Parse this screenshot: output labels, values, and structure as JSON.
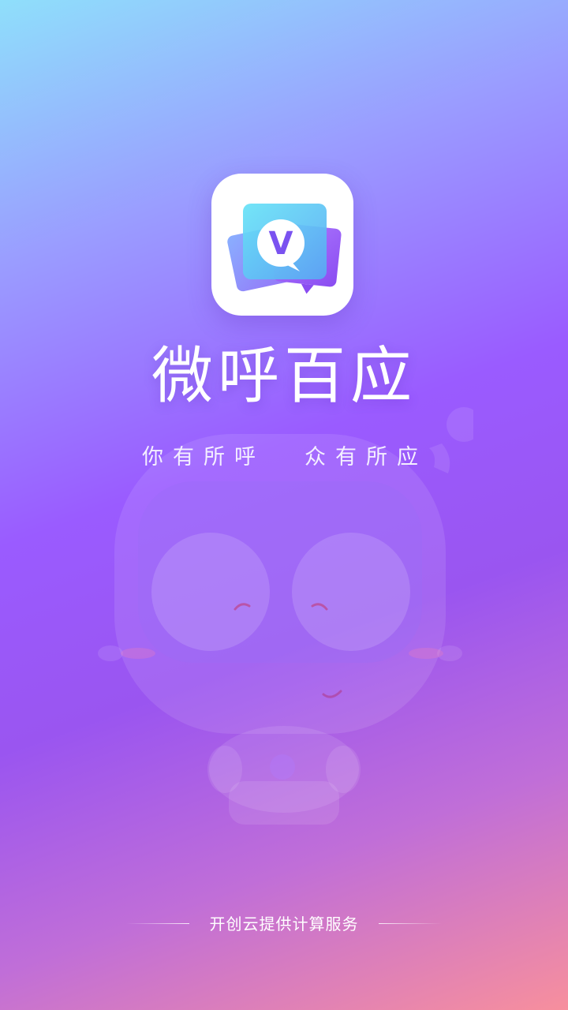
{
  "splash": {
    "app_name": "微呼百应",
    "slogan_left": "你有所呼",
    "slogan_right": "众有所应",
    "icon_letter": "V",
    "footer_text": "开创云提供计算服务"
  },
  "colors": {
    "gradient_top": "#8fdffb",
    "gradient_mid": "#9a5bff",
    "gradient_bottom": "#f78f9d",
    "icon_bg": "#ffffff",
    "bubble_cyan": "#5ed6f5",
    "bubble_purple": "#9a4df5"
  },
  "icons": {
    "app_icon": "chat-bubbles-v-icon",
    "mascot": "robot-mascot-watermark"
  }
}
